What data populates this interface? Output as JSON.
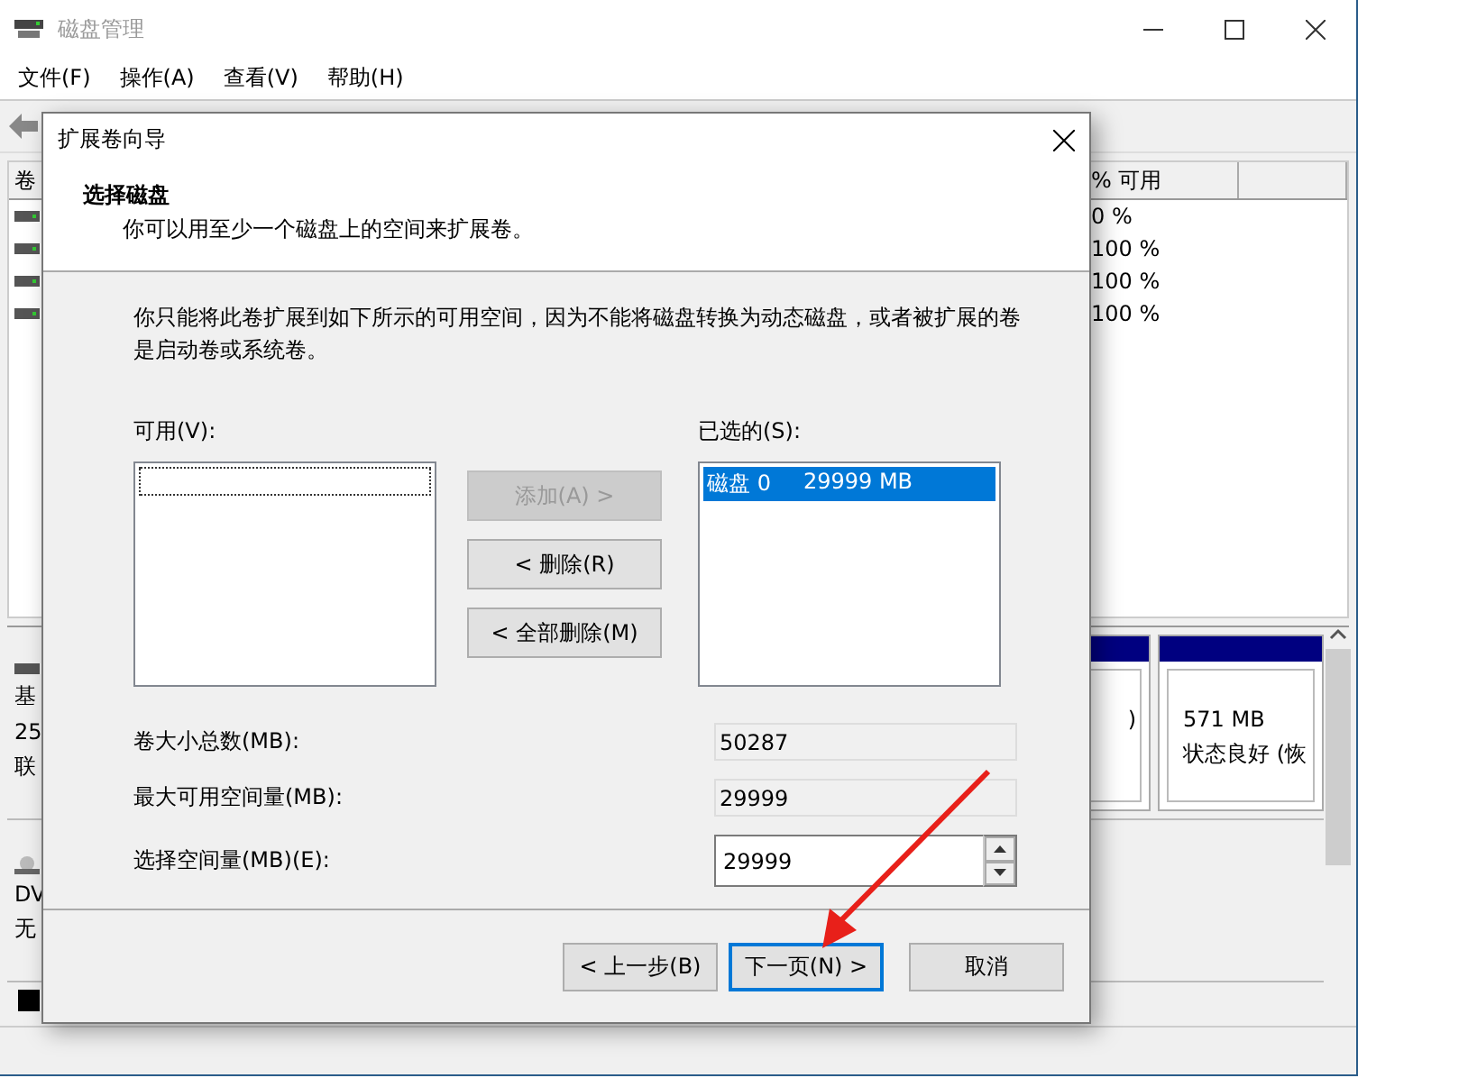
{
  "main_window": {
    "title": "磁盘管理",
    "menu": [
      "文件(F)",
      "操作(A)",
      "查看(V)",
      "帮助(H)"
    ],
    "volume_table": {
      "columns": [
        "卷",
        "% 可用"
      ],
      "rows": [
        {
          "percent_free": "0 %"
        },
        {
          "percent_free": "100 %"
        },
        {
          "percent_free": "100 %"
        },
        {
          "percent_free": "100 %"
        }
      ]
    },
    "disks": [
      {
        "kind": "basic",
        "label_lines": [
          "基",
          "25",
          "联"
        ],
        "partitions": [
          {
            "text_lines": [
              ")"
            ]
          },
          {
            "text_lines": [
              "571 MB",
              "状态良好 (恢"
            ]
          }
        ]
      },
      {
        "kind": "dvd",
        "label_lines": [
          "DV",
          "无"
        ]
      }
    ]
  },
  "dialog": {
    "title": "扩展卷向导",
    "heading": "选择磁盘",
    "subheading": "你可以用至少一个磁盘上的空间来扩展卷。",
    "description": "你只能将此卷扩展到如下所示的可用空间，因为不能将磁盘转换为动态磁盘，或者被扩展的卷是启动卷或系统卷。",
    "available": {
      "label": "可用(V):"
    },
    "move_buttons": [
      {
        "label": "添加(A) >",
        "disabled": true
      },
      {
        "label": "< 删除(R)",
        "disabled": false
      },
      {
        "label": "< 全部删除(M)",
        "disabled": false
      }
    ],
    "selected_list": {
      "label": "已选的(S):",
      "items": [
        {
          "disk": "磁盘 0",
          "size": "29999 MB",
          "selected": true
        }
      ]
    },
    "fields": [
      {
        "kind": "readonly",
        "label": "卷大小总数(MB):",
        "value": "50287"
      },
      {
        "kind": "readonly",
        "label": "最大可用空间量(MB):",
        "value": "29999"
      },
      {
        "kind": "spin",
        "label": "选择空间量(MB)(E):",
        "value": "29999"
      }
    ],
    "footer_buttons": [
      {
        "label": "< 上一步(B)",
        "focused": false
      },
      {
        "label": "下一页(N) >",
        "focused": true
      },
      {
        "label": "取消",
        "focused": false
      }
    ]
  }
}
